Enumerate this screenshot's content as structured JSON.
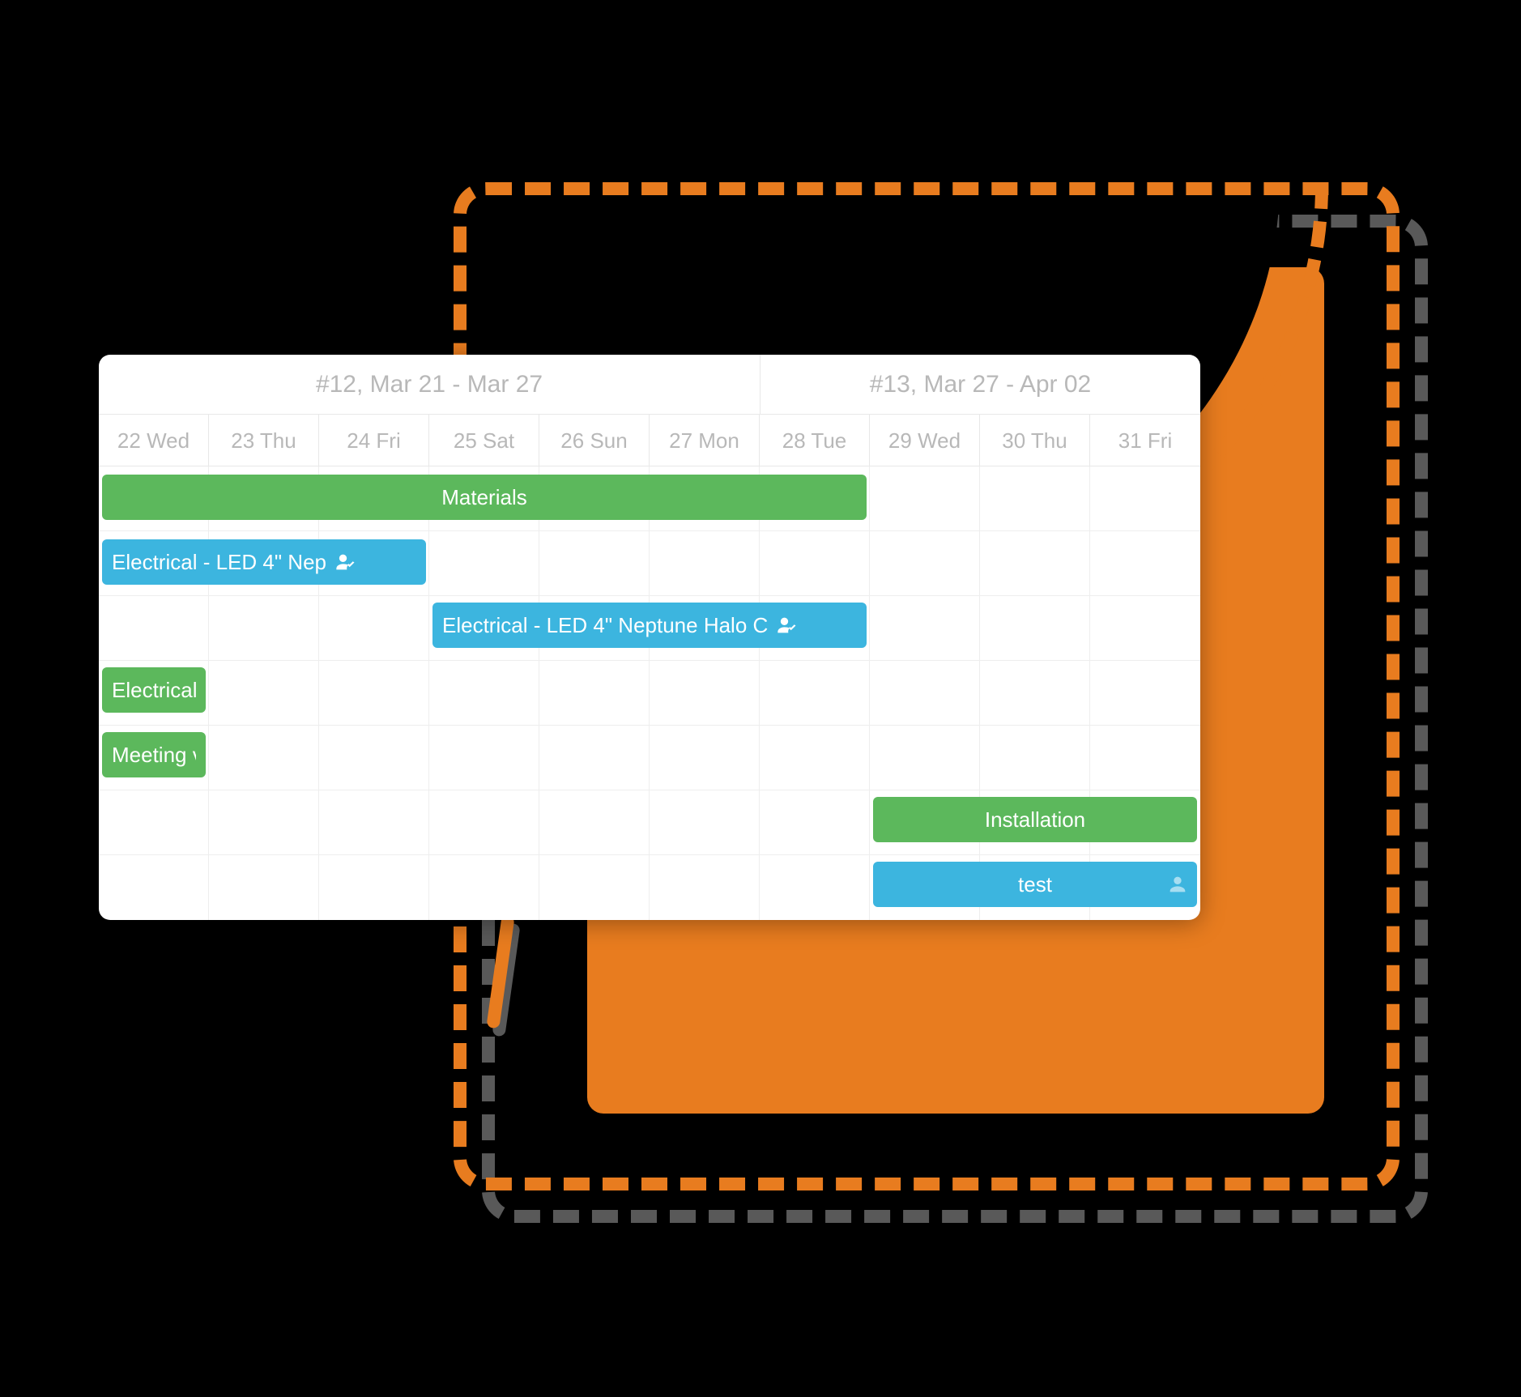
{
  "colors": {
    "green": "#5cb85c",
    "blue": "#3cb5df",
    "accent": "#e87c1f"
  },
  "weeks": [
    {
      "label": "#12, Mar 21 - Mar 27"
    },
    {
      "label": "#13, Mar 27 - Apr 02"
    }
  ],
  "days": [
    "22 Wed",
    "23 Thu",
    "24 Fri",
    "25 Sat",
    "26 Sun",
    "27 Mon",
    "28 Tue",
    "29 Wed",
    "30 Thu",
    "31 Fri"
  ],
  "bars": [
    {
      "label": "Materials",
      "row": 0,
      "color": "green",
      "start": 0,
      "span": 7,
      "align": "center",
      "icon": null
    },
    {
      "label": "Electrical - LED 4\" Nep",
      "row": 1,
      "color": "blue",
      "start": 0,
      "span": 3,
      "align": "left",
      "icon": "user-check"
    },
    {
      "label": "Electrical - LED 4\" Neptune Halo C",
      "row": 2,
      "color": "blue",
      "start": 3,
      "span": 4,
      "align": "left",
      "icon": "user-check"
    },
    {
      "label": "Electrical",
      "row": 3,
      "color": "green",
      "start": 0,
      "span": 1,
      "align": "left",
      "icon": null
    },
    {
      "label": "Meeting v",
      "row": 4,
      "color": "green",
      "start": 0,
      "span": 1,
      "align": "left",
      "icon": null
    },
    {
      "label": "Installation",
      "row": 5,
      "color": "green",
      "start": 7,
      "span": 3,
      "align": "center",
      "icon": null
    },
    {
      "label": "test",
      "row": 6,
      "color": "blue",
      "start": 7,
      "span": 3,
      "align": "center",
      "icon": "user-pale"
    }
  ]
}
